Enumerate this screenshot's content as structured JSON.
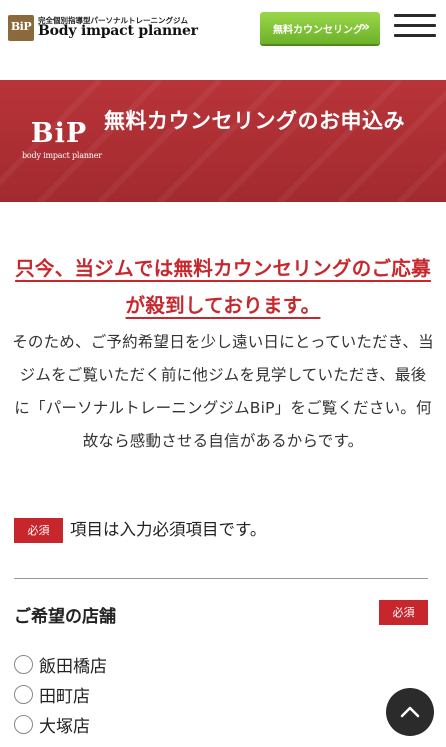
{
  "header": {
    "logo_mark": "BiP",
    "logo_tagline": "完全個別指導型パーソナルトレーニングジム",
    "logo_name": "Body impact planner",
    "cta_label": "無料カウンセリング",
    "cta_arrow": "»"
  },
  "banner": {
    "logo_big": "BiP",
    "logo_small": "body impact planner",
    "title": "無料カウンセリングのお申込み"
  },
  "notice": {
    "headline": "只今、当ジムでは無料カウンセリングのご応募が殺到しております。",
    "body": "そのため、ご予約希望日を少し遠い日にとっていただき、当ジムをご覧いただく前に他ジムを見学していただき、最後に「パーソナルトレーニングジムBiP」をご覧ください。何故なら感動させる自信があるからです。"
  },
  "required_note": {
    "badge": "必須",
    "text": "項目は入力必須項目です。"
  },
  "store_field": {
    "label": "ご希望の店舗",
    "badge": "必須",
    "options": [
      "飯田橋店",
      "田町店",
      "大塚店"
    ]
  },
  "colors": {
    "brand_red": "#c7262c",
    "cta_green": "#7cc233",
    "logo_gold": "#8a6a3c"
  },
  "icons": {
    "menu": "hamburger-icon",
    "scroll_top": "chevron-up-icon"
  }
}
